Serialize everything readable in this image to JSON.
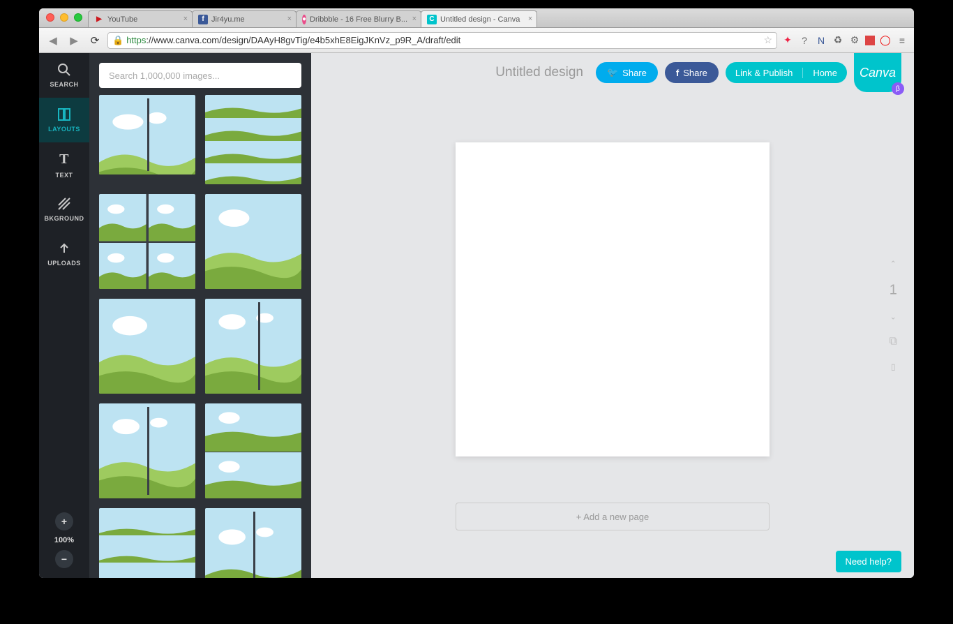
{
  "browser": {
    "tabs": [
      {
        "label": "YouTube",
        "fav": "▶"
      },
      {
        "label": "Jir4yu.me",
        "fav": "f"
      },
      {
        "label": "Dribbble - 16 Free Blurry B...",
        "fav": "●"
      },
      {
        "label": "Untitled design - Canva",
        "fav": "C"
      }
    ],
    "url_https": "https",
    "url_rest": "://www.canva.com/design/DAAyH8gvTig/e4b5xhE8EigJKnVz_p9R_A/draft/edit"
  },
  "sidebar": {
    "items": [
      {
        "label": "SEARCH"
      },
      {
        "label": "LAYOUTS"
      },
      {
        "label": "TEXT"
      },
      {
        "label": "BKGROUND"
      },
      {
        "label": "UPLOADS"
      }
    ],
    "zoom": "100%"
  },
  "panel": {
    "search_placeholder": "Search 1,000,000 images..."
  },
  "header": {
    "title": "Untitled design",
    "twitter": "Share",
    "facebook": "Share",
    "linkpublish": "Link & Publish",
    "home": "Home",
    "logo": "Canva",
    "beta": "β"
  },
  "stage": {
    "page_number": "1",
    "add_page": "+ Add a new page",
    "help": "Need help?"
  }
}
